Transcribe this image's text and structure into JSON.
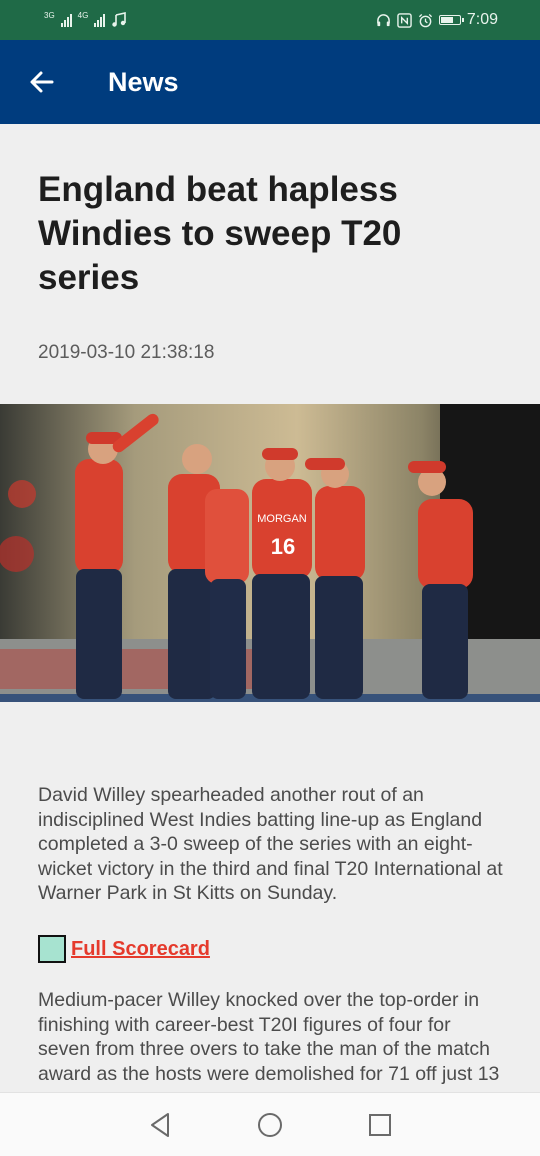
{
  "status_bar": {
    "net1": "3G",
    "net2": "4G",
    "time": "7:09",
    "icons": [
      "signal-icon",
      "signal-icon",
      "music-note-icon",
      "headphones-icon",
      "nfc-icon",
      "alarm-icon",
      "battery-icon"
    ]
  },
  "app_bar": {
    "title": "News",
    "back_icon": "arrow-left-icon",
    "color": "#003c7e"
  },
  "article": {
    "headline": "England beat hapless Windies to sweep T20 series",
    "date": "2019-03-10 21:38:18",
    "image": {
      "jersey_text": "MORGAN",
      "jersey_number": "16"
    },
    "paragraph_1": "David Willey spearheaded another rout of an indisciplined West Indies batting line-up as England completed a 3-0 sweep of the series with an eight-wicket victory in the third and final T20 International at Warner Park in St Kitts on Sunday.",
    "scorecard_link": "Full Scorecard",
    "paragraph_2": "Medium-pacer Willey knocked over the top-order in finishing with career-best T20I figures of four for seven from three overs to take the man of the match award as the hosts were demolished for 71 off just 13"
  },
  "nav_bar": {
    "back_icon": "triangle-back-icon",
    "home_icon": "circle-home-icon",
    "recents_icon": "square-recents-icon"
  },
  "colors": {
    "status_bar": "#1f6a47",
    "link": "#e53a2c",
    "background": "#efefef"
  }
}
